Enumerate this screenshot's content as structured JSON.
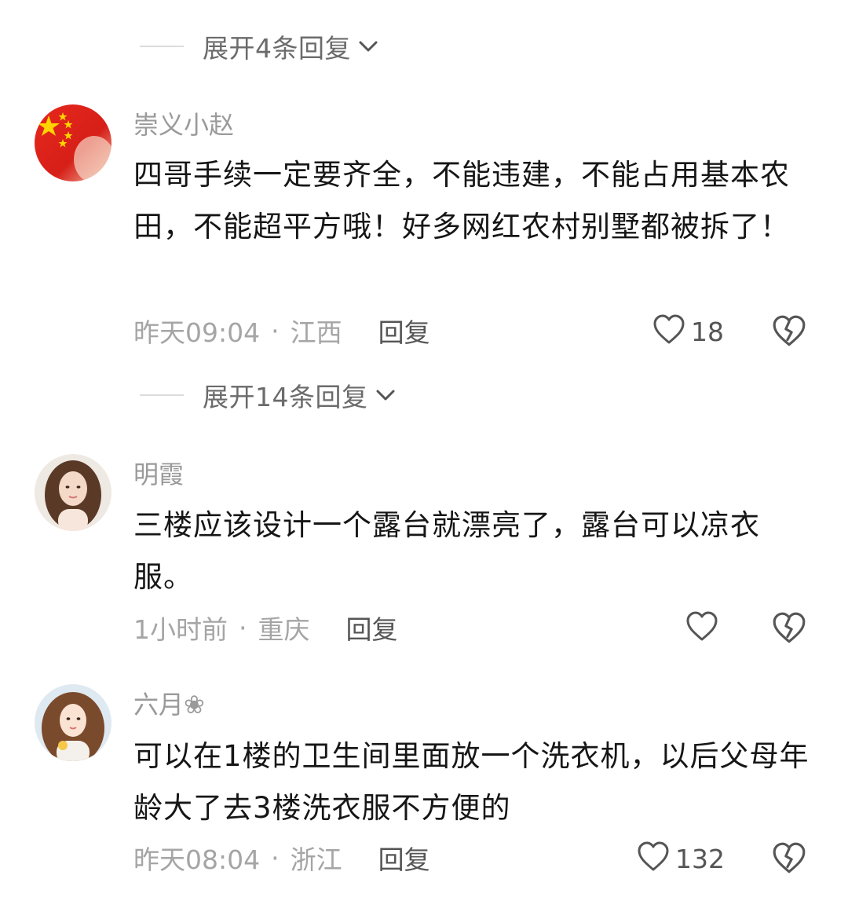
{
  "expand_top": {
    "label": "展开4条回复"
  },
  "comments": [
    {
      "username": "崇义小赵",
      "text": "四哥手续一定要齐全，不能违建，不能占用基本农田，不能超平方哦！好多网红农村别墅都被拆了！",
      "time": "昨天09:04",
      "dot": "·",
      "location": "江西",
      "reply_label": "回复",
      "likes": "18",
      "avatar": "flag-avatar",
      "expand_label": "展开14条回复"
    },
    {
      "username": "明霞",
      "text": "三楼应该设计一个露台就漂亮了，露台可以凉衣服。",
      "time": "1小时前",
      "dot": "·",
      "location": "重庆",
      "reply_label": "回复",
      "likes": "",
      "avatar": "woman-photo-avatar"
    },
    {
      "username": "六月❀",
      "text": "可以在1楼的卫生间里面放一个洗衣机，以后父母年龄大了去3楼洗衣服不方便的",
      "time": "昨天08:04",
      "dot": "·",
      "location": "浙江",
      "reply_label": "回复",
      "likes": "132",
      "avatar": "illustrated-girl-avatar"
    }
  ],
  "icons": {
    "like": "heart-outline-icon",
    "dislike": "broken-heart-icon",
    "expand": "chevron-down-icon"
  },
  "colors": {
    "text": "#161616",
    "meta": "#a5a5a5",
    "username": "#9a9a9a",
    "flag_red": "#e02a1f",
    "star_yellow": "#ffd400"
  }
}
